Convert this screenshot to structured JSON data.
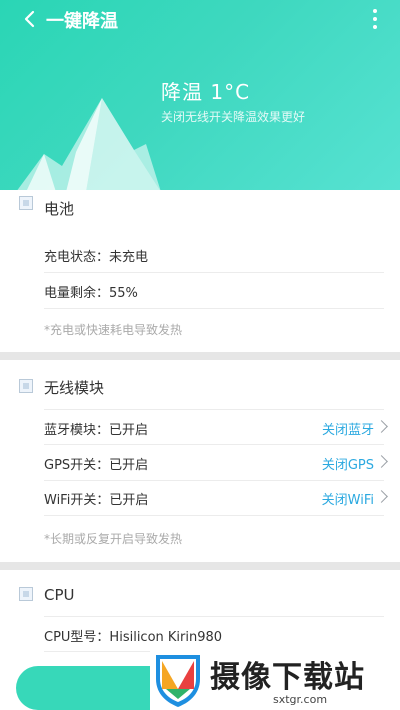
{
  "header": {
    "title": "一键降温",
    "temp_label": "降温 1°C",
    "hint": "关闭无线开关降温效果更好"
  },
  "battery": {
    "title": "电池",
    "rows": [
      {
        "label": "充电状态：未充电"
      },
      {
        "label": "电量剩余：55%"
      }
    ],
    "note": "*充电或快速耗电导致发热"
  },
  "wireless": {
    "title": "无线模块",
    "rows": [
      {
        "label": "蓝牙模块：已开启",
        "action": "关闭蓝牙"
      },
      {
        "label": "GPS开关：已开启",
        "action": "关闭GPS"
      },
      {
        "label": "WiFi开关：已开启",
        "action": "关闭WiFi"
      }
    ],
    "note": "*长期或反复开启导致发热"
  },
  "cpu": {
    "title": "CPU",
    "rows": [
      {
        "label": "CPU型号：Hisilicon Kirin980"
      }
    ]
  },
  "watermark": {
    "brand": "摄像下载站",
    "url": "sxtgr.com"
  },
  "colors": {
    "accent": "#2ad6b5",
    "link": "#2ba9e0"
  }
}
